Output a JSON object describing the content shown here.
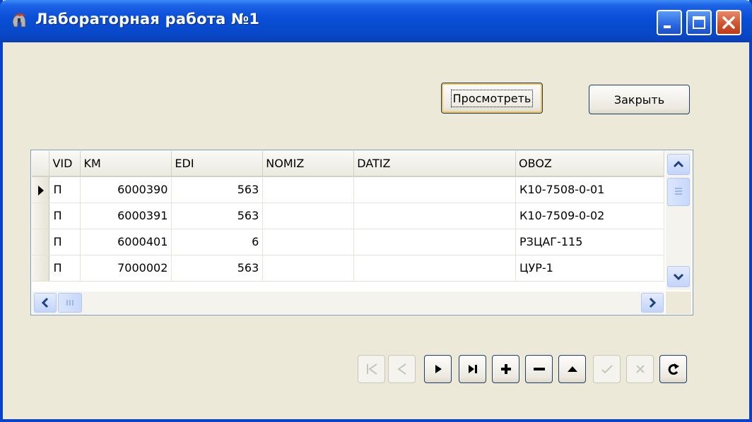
{
  "window": {
    "title": "Лабораторная работа №1",
    "icons": {
      "app": "spartan-helmet-icon",
      "minimize": "minimize-icon",
      "maximize": "maximize-icon",
      "close": "close-icon"
    }
  },
  "buttons": {
    "view_label": "Просмотреть",
    "close_label": "Закрыть"
  },
  "grid": {
    "columns": [
      "VID",
      "KM",
      "EDI",
      "NOMIZ",
      "DATIZ",
      "OBOZ"
    ],
    "rows": [
      {
        "VID": "П",
        "KM": "6000390",
        "EDI": "563",
        "NOMIZ": "",
        "DATIZ": "",
        "OBOZ": "К10-7508-0-01",
        "current": true
      },
      {
        "VID": "П",
        "KM": "6000391",
        "EDI": "563",
        "NOMIZ": "",
        "DATIZ": "",
        "OBOZ": "К10-7509-0-02",
        "current": false
      },
      {
        "VID": "П",
        "KM": "6000401",
        "EDI": "6",
        "NOMIZ": "",
        "DATIZ": "",
        "OBOZ": "РЗЦАГ-115",
        "current": false
      },
      {
        "VID": "П",
        "KM": "7000002",
        "EDI": "563",
        "NOMIZ": "",
        "DATIZ": "",
        "OBOZ": "ЦУР-1",
        "current": false
      }
    ]
  },
  "navigator": {
    "buttons": [
      {
        "name": "first-record-icon",
        "enabled": false
      },
      {
        "name": "prior-record-icon",
        "enabled": false
      },
      {
        "name": "next-record-icon",
        "enabled": true
      },
      {
        "name": "last-record-icon",
        "enabled": true
      },
      {
        "name": "insert-record-icon",
        "enabled": true
      },
      {
        "name": "delete-record-icon",
        "enabled": true
      },
      {
        "name": "edit-record-icon",
        "enabled": true
      },
      {
        "name": "post-record-icon",
        "enabled": false
      },
      {
        "name": "cancel-record-icon",
        "enabled": false
      },
      {
        "name": "refresh-icon",
        "enabled": true
      }
    ]
  },
  "colors": {
    "titlebar": "#0a4fd8",
    "window_bg": "#ece9d8",
    "close_button": "#d2532e",
    "focus": "#f0c25a"
  }
}
